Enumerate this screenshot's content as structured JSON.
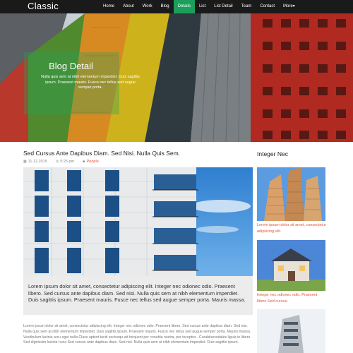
{
  "brand": {
    "logo": "Classic"
  },
  "nav": {
    "items": [
      "Home",
      "About",
      "Work",
      "Blog",
      "Details",
      "List",
      "List Detail",
      "Team",
      "Contact",
      "More"
    ],
    "active": "Details",
    "more_caret": "▾"
  },
  "hero": {
    "title": "Blog Detail",
    "subtitle": "Nulla quis sem at nibh elementum imperdiet. Duis sagittis ipsum. Praesent mauris. Fusce nec tellus sed augue semper porta."
  },
  "post": {
    "title": "Sed Cursus Ante Dapibus Diam. Sed Nisi. Nulla Quis Sem.",
    "date": "11.12.2015",
    "time": "5:26 pm",
    "category": "People",
    "quote": "Lorem ipsum dolor sit amet, consectetur adipiscing elit. Integer nec odionec odio. Praesent libero. Sed cursus ante dapibus diam. Sed nisi. Nulla quis sem at nibh elementum imperdiet. Duis sagittis ipsum. Praesent mauris. Fusce nec tellus sed augue semper porta. Mauris massa.",
    "body": "Lorem ipsum dolor sit amet, consectetur adipiscing elit. Integer nec odionec odio. Praesent libero. Sed cursus ante dapibus diam. Sed nisi. Nulla quis sem at nibh elementum imperdiet. Duis sagittis ipsum. Praesent mauris. Fusce nec tellus sed augue semper porta. Mauris massa. Vestibulum lacinia arcu eget nulla.Class aptent taciti sociosqu ad torquent per conubia nostra, per inceptos . Curabitursodales ligula in libero. Sed dignissim lacinia nunc.Sed cursus ante dapibus diam. Sed nisi. Nulla quis sem at nibh elementum imperdiet. Duis sagittis ipsum."
  },
  "sidebar": {
    "title": "Integer Nec",
    "cards": [
      {
        "caption": "Lorem ipsum dolor sit amet, consectetur adipiscing elit."
      },
      {
        "caption": "Integer nec odionec odio. Praesent libero.Sed cursus."
      },
      {
        "caption": ""
      }
    ]
  },
  "icons": {
    "calendar": "calendar-icon",
    "clock": "clock-icon",
    "tag": "tag-icon"
  },
  "colors": {
    "nav_bg": "#1a1a1a",
    "active": "#1aa05a",
    "accent": "#e0553a",
    "quote_bg": "#ececec"
  }
}
